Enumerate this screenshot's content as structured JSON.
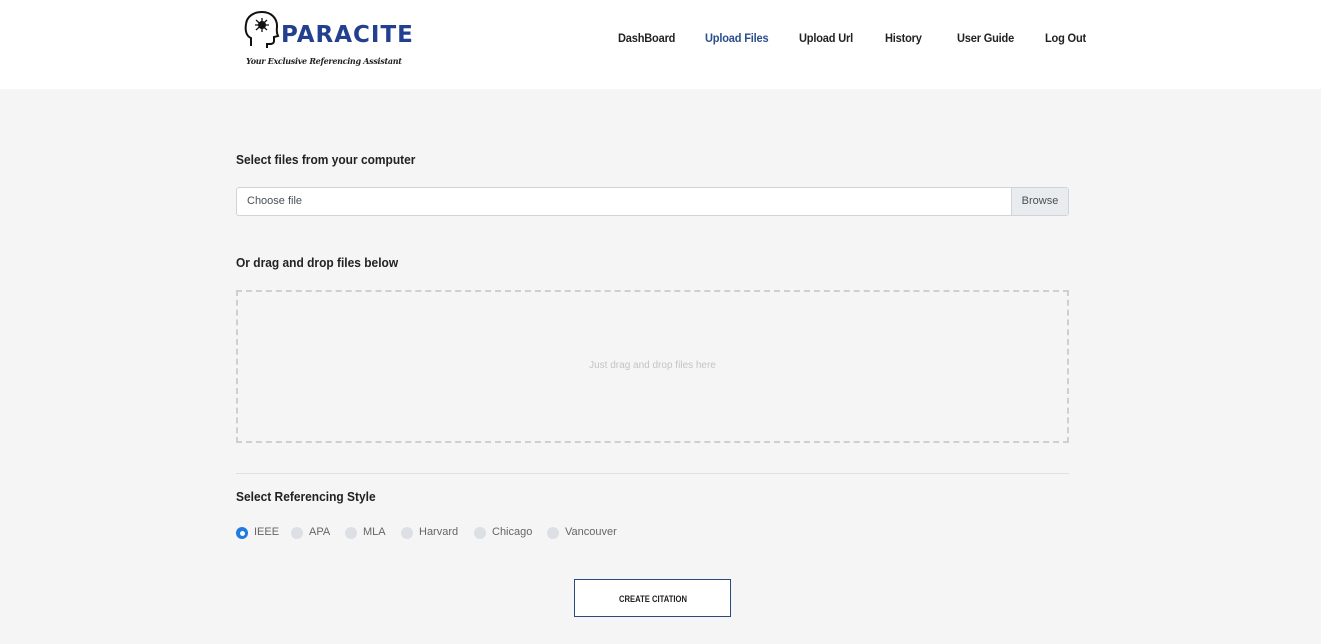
{
  "brand": {
    "name": "PARACITE",
    "tagline": "Your Exclusive Referencing Assistant",
    "color": "#233f8f"
  },
  "nav": {
    "items": [
      {
        "label": "DashBoard",
        "active": false
      },
      {
        "label": "Upload Files",
        "active": true
      },
      {
        "label": "Upload Url",
        "active": false
      },
      {
        "label": "History",
        "active": false
      },
      {
        "label": "User Guide",
        "active": false
      },
      {
        "label": "Log Out",
        "active": false
      }
    ]
  },
  "upload": {
    "select_title": "Select files from your computer",
    "file_placeholder": "Choose file",
    "browse_label": "Browse",
    "drag_title": "Or drag and drop files below",
    "drop_hint": "Just drag and drop files here"
  },
  "style": {
    "title": "Select Referencing Style",
    "options": [
      "IEEE",
      "APA",
      "MLA",
      "Harvard",
      "Chicago",
      "Vancouver"
    ],
    "selected": "IEEE"
  },
  "actions": {
    "create_label": "CREATE CITATION"
  }
}
